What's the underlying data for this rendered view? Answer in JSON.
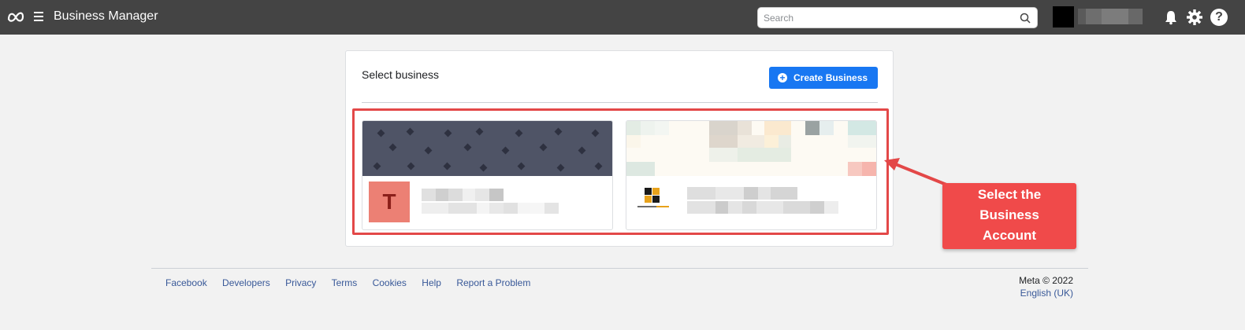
{
  "header": {
    "app_title": "Business Manager",
    "search_placeholder": "Search",
    "icons": [
      "meta-logo-icon",
      "hamburger-icon",
      "search-icon",
      "bell-icon",
      "gear-icon",
      "help-icon"
    ],
    "help_glyph": "?"
  },
  "panel": {
    "title": "Select business",
    "create_button_label": "Create Business",
    "businesses": [
      {
        "logo_letter": "T",
        "logo_color": "#ec8074"
      },
      {
        "logo_letter": "",
        "logo_color": "#000000"
      }
    ]
  },
  "annotation": {
    "text_line1": "Select the",
    "text_line2": "Business",
    "text_line3": "Account",
    "color": "#f04a4a"
  },
  "footer": {
    "links": [
      "Facebook",
      "Developers",
      "Privacy",
      "Terms",
      "Cookies",
      "Help",
      "Report a Problem"
    ],
    "copyright": "Meta © 2022",
    "language": "English (UK)"
  },
  "colors": {
    "topbar": "#444444",
    "accent": "#1877f2",
    "link": "#385898"
  }
}
